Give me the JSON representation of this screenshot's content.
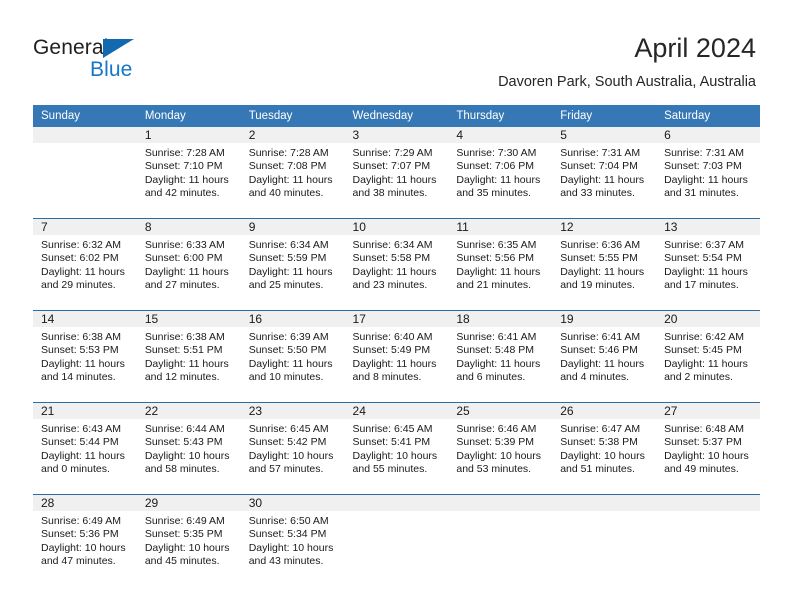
{
  "logo": {
    "word_general": "General",
    "word_blue": "Blue",
    "triangle_color": "#1269b0",
    "blue_color": "#1477c9"
  },
  "header": {
    "title": "April 2024",
    "subtitle": "Davoren Park, South Australia, Australia"
  },
  "colors": {
    "header_bar": "#3578b5",
    "week_separator": "#2a6ca8",
    "daynum_band": "#f0f0f0",
    "text": "#1a1a1a"
  },
  "weekday_headers": [
    "Sunday",
    "Monday",
    "Tuesday",
    "Wednesday",
    "Thursday",
    "Friday",
    "Saturday"
  ],
  "weeks": [
    [
      {
        "day": "",
        "sunrise": "",
        "sunset": "",
        "daylight_line1": "",
        "daylight_line2": ""
      },
      {
        "day": "1",
        "sunrise": "Sunrise: 7:28 AM",
        "sunset": "Sunset: 7:10 PM",
        "daylight_line1": "Daylight: 11 hours",
        "daylight_line2": "and 42 minutes."
      },
      {
        "day": "2",
        "sunrise": "Sunrise: 7:28 AM",
        "sunset": "Sunset: 7:08 PM",
        "daylight_line1": "Daylight: 11 hours",
        "daylight_line2": "and 40 minutes."
      },
      {
        "day": "3",
        "sunrise": "Sunrise: 7:29 AM",
        "sunset": "Sunset: 7:07 PM",
        "daylight_line1": "Daylight: 11 hours",
        "daylight_line2": "and 38 minutes."
      },
      {
        "day": "4",
        "sunrise": "Sunrise: 7:30 AM",
        "sunset": "Sunset: 7:06 PM",
        "daylight_line1": "Daylight: 11 hours",
        "daylight_line2": "and 35 minutes."
      },
      {
        "day": "5",
        "sunrise": "Sunrise: 7:31 AM",
        "sunset": "Sunset: 7:04 PM",
        "daylight_line1": "Daylight: 11 hours",
        "daylight_line2": "and 33 minutes."
      },
      {
        "day": "6",
        "sunrise": "Sunrise: 7:31 AM",
        "sunset": "Sunset: 7:03 PM",
        "daylight_line1": "Daylight: 11 hours",
        "daylight_line2": "and 31 minutes."
      }
    ],
    [
      {
        "day": "7",
        "sunrise": "Sunrise: 6:32 AM",
        "sunset": "Sunset: 6:02 PM",
        "daylight_line1": "Daylight: 11 hours",
        "daylight_line2": "and 29 minutes."
      },
      {
        "day": "8",
        "sunrise": "Sunrise: 6:33 AM",
        "sunset": "Sunset: 6:00 PM",
        "daylight_line1": "Daylight: 11 hours",
        "daylight_line2": "and 27 minutes."
      },
      {
        "day": "9",
        "sunrise": "Sunrise: 6:34 AM",
        "sunset": "Sunset: 5:59 PM",
        "daylight_line1": "Daylight: 11 hours",
        "daylight_line2": "and 25 minutes."
      },
      {
        "day": "10",
        "sunrise": "Sunrise: 6:34 AM",
        "sunset": "Sunset: 5:58 PM",
        "daylight_line1": "Daylight: 11 hours",
        "daylight_line2": "and 23 minutes."
      },
      {
        "day": "11",
        "sunrise": "Sunrise: 6:35 AM",
        "sunset": "Sunset: 5:56 PM",
        "daylight_line1": "Daylight: 11 hours",
        "daylight_line2": "and 21 minutes."
      },
      {
        "day": "12",
        "sunrise": "Sunrise: 6:36 AM",
        "sunset": "Sunset: 5:55 PM",
        "daylight_line1": "Daylight: 11 hours",
        "daylight_line2": "and 19 minutes."
      },
      {
        "day": "13",
        "sunrise": "Sunrise: 6:37 AM",
        "sunset": "Sunset: 5:54 PM",
        "daylight_line1": "Daylight: 11 hours",
        "daylight_line2": "and 17 minutes."
      }
    ],
    [
      {
        "day": "14",
        "sunrise": "Sunrise: 6:38 AM",
        "sunset": "Sunset: 5:53 PM",
        "daylight_line1": "Daylight: 11 hours",
        "daylight_line2": "and 14 minutes."
      },
      {
        "day": "15",
        "sunrise": "Sunrise: 6:38 AM",
        "sunset": "Sunset: 5:51 PM",
        "daylight_line1": "Daylight: 11 hours",
        "daylight_line2": "and 12 minutes."
      },
      {
        "day": "16",
        "sunrise": "Sunrise: 6:39 AM",
        "sunset": "Sunset: 5:50 PM",
        "daylight_line1": "Daylight: 11 hours",
        "daylight_line2": "and 10 minutes."
      },
      {
        "day": "17",
        "sunrise": "Sunrise: 6:40 AM",
        "sunset": "Sunset: 5:49 PM",
        "daylight_line1": "Daylight: 11 hours",
        "daylight_line2": "and 8 minutes."
      },
      {
        "day": "18",
        "sunrise": "Sunrise: 6:41 AM",
        "sunset": "Sunset: 5:48 PM",
        "daylight_line1": "Daylight: 11 hours",
        "daylight_line2": "and 6 minutes."
      },
      {
        "day": "19",
        "sunrise": "Sunrise: 6:41 AM",
        "sunset": "Sunset: 5:46 PM",
        "daylight_line1": "Daylight: 11 hours",
        "daylight_line2": "and 4 minutes."
      },
      {
        "day": "20",
        "sunrise": "Sunrise: 6:42 AM",
        "sunset": "Sunset: 5:45 PM",
        "daylight_line1": "Daylight: 11 hours",
        "daylight_line2": "and 2 minutes."
      }
    ],
    [
      {
        "day": "21",
        "sunrise": "Sunrise: 6:43 AM",
        "sunset": "Sunset: 5:44 PM",
        "daylight_line1": "Daylight: 11 hours",
        "daylight_line2": "and 0 minutes."
      },
      {
        "day": "22",
        "sunrise": "Sunrise: 6:44 AM",
        "sunset": "Sunset: 5:43 PM",
        "daylight_line1": "Daylight: 10 hours",
        "daylight_line2": "and 58 minutes."
      },
      {
        "day": "23",
        "sunrise": "Sunrise: 6:45 AM",
        "sunset": "Sunset: 5:42 PM",
        "daylight_line1": "Daylight: 10 hours",
        "daylight_line2": "and 57 minutes."
      },
      {
        "day": "24",
        "sunrise": "Sunrise: 6:45 AM",
        "sunset": "Sunset: 5:41 PM",
        "daylight_line1": "Daylight: 10 hours",
        "daylight_line2": "and 55 minutes."
      },
      {
        "day": "25",
        "sunrise": "Sunrise: 6:46 AM",
        "sunset": "Sunset: 5:39 PM",
        "daylight_line1": "Daylight: 10 hours",
        "daylight_line2": "and 53 minutes."
      },
      {
        "day": "26",
        "sunrise": "Sunrise: 6:47 AM",
        "sunset": "Sunset: 5:38 PM",
        "daylight_line1": "Daylight: 10 hours",
        "daylight_line2": "and 51 minutes."
      },
      {
        "day": "27",
        "sunrise": "Sunrise: 6:48 AM",
        "sunset": "Sunset: 5:37 PM",
        "daylight_line1": "Daylight: 10 hours",
        "daylight_line2": "and 49 minutes."
      }
    ],
    [
      {
        "day": "28",
        "sunrise": "Sunrise: 6:49 AM",
        "sunset": "Sunset: 5:36 PM",
        "daylight_line1": "Daylight: 10 hours",
        "daylight_line2": "and 47 minutes."
      },
      {
        "day": "29",
        "sunrise": "Sunrise: 6:49 AM",
        "sunset": "Sunset: 5:35 PM",
        "daylight_line1": "Daylight: 10 hours",
        "daylight_line2": "and 45 minutes."
      },
      {
        "day": "30",
        "sunrise": "Sunrise: 6:50 AM",
        "sunset": "Sunset: 5:34 PM",
        "daylight_line1": "Daylight: 10 hours",
        "daylight_line2": "and 43 minutes."
      },
      {
        "day": "",
        "sunrise": "",
        "sunset": "",
        "daylight_line1": "",
        "daylight_line2": ""
      },
      {
        "day": "",
        "sunrise": "",
        "sunset": "",
        "daylight_line1": "",
        "daylight_line2": ""
      },
      {
        "day": "",
        "sunrise": "",
        "sunset": "",
        "daylight_line1": "",
        "daylight_line2": ""
      },
      {
        "day": "",
        "sunrise": "",
        "sunset": "",
        "daylight_line1": "",
        "daylight_line2": ""
      }
    ]
  ]
}
